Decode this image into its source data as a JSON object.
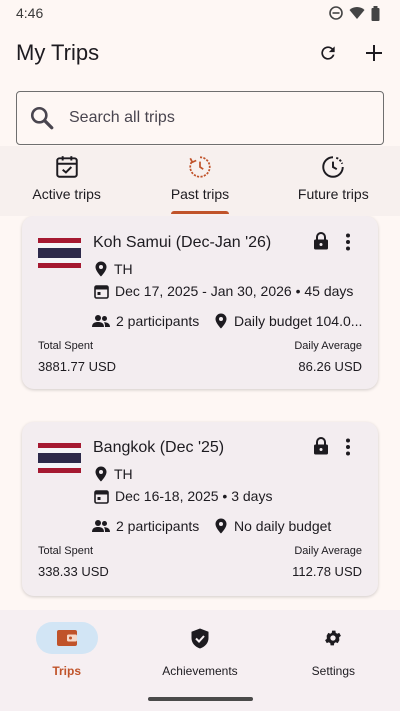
{
  "status_bar": {
    "time": "4:46"
  },
  "app_bar": {
    "title": "My Trips"
  },
  "search": {
    "placeholder": "Search all trips"
  },
  "tabs": [
    {
      "label": "Active trips",
      "icon": "calendar-check-icon",
      "active": false
    },
    {
      "label": "Past trips",
      "icon": "history-icon",
      "active": true
    },
    {
      "label": "Future trips",
      "icon": "clock-icon",
      "active": false
    }
  ],
  "trips": [
    {
      "title": "Koh Samui (Dec-Jan '26)",
      "country": "TH",
      "dates": "Dec 17, 2025 - Jan 30, 2026 • 45 days",
      "participants": "2 participants",
      "budget": "Daily budget 104.0...",
      "total_label": "Total Spent",
      "total_value": "3881.77 USD",
      "avg_label": "Daily Average",
      "avg_value": "86.26 USD"
    },
    {
      "title": "Bangkok (Dec '25)",
      "country": "TH",
      "dates": "Dec 16-18, 2025 • 3 days",
      "participants": "2 participants",
      "budget": "No daily budget",
      "total_label": "Total Spent",
      "total_value": "338.33 USD",
      "avg_label": "Daily Average",
      "avg_value": "112.78 USD"
    }
  ],
  "bottom_nav": [
    {
      "label": "Trips",
      "icon": "wallet-icon",
      "active": true
    },
    {
      "label": "Achievements",
      "icon": "shield-check-icon",
      "active": false
    },
    {
      "label": "Settings",
      "icon": "gear-icon",
      "active": false
    }
  ],
  "colors": {
    "accent": "#c0532a",
    "nav_pill": "#d2e5f5",
    "flag_red": "#a51931",
    "flag_blue": "#2d2a4a"
  }
}
